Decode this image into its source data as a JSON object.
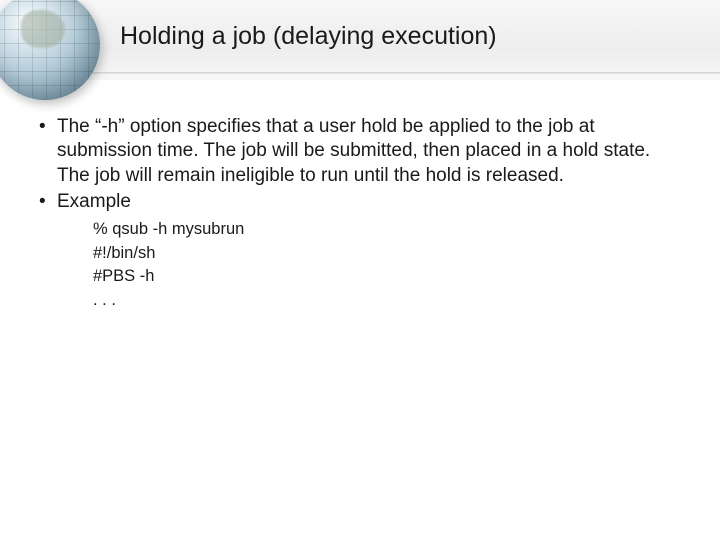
{
  "title": "Holding a job (delaying execution)",
  "bullets": [
    "The “-h” option specifies that a user hold be applied to the job at submission time. The job will be submitted, then placed in a hold state. The job will remain ineligible to run until the hold is released.",
    "Example"
  ],
  "code": [
    "% qsub -h mysubrun",
    "#!/bin/sh",
    "#PBS -h",
    ". . ."
  ]
}
